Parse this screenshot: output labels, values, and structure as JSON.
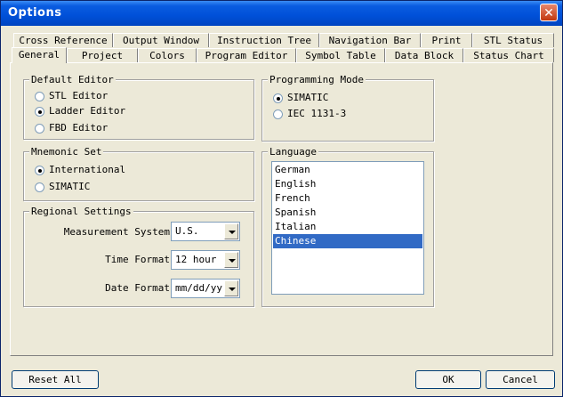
{
  "window": {
    "title": "Options"
  },
  "tabs_back": [
    "Cross Reference",
    "Output Window",
    "Instruction Tree",
    "Navigation Bar",
    "Print",
    "STL Status"
  ],
  "tabs_front": [
    "General",
    "Project",
    "Colors",
    "Program Editor",
    "Symbol Table",
    "Data Block",
    "Status Chart"
  ],
  "default_editor": {
    "legend": "Default Editor",
    "options": [
      "STL Editor",
      "Ladder Editor",
      "FBD Editor"
    ],
    "selected": "Ladder Editor"
  },
  "mnemonic_set": {
    "legend": "Mnemonic Set",
    "options": [
      "International",
      "SIMATIC"
    ],
    "selected": "International"
  },
  "regional": {
    "legend": "Regional Settings",
    "measurement_label": "Measurement System",
    "measurement_value": "U.S.",
    "time_label": "Time Format",
    "time_value": "12 hour",
    "date_label": "Date Format",
    "date_value": "mm/dd/yy"
  },
  "programming_mode": {
    "legend": "Programming Mode",
    "options": [
      "SIMATIC",
      "IEC 1131-3"
    ],
    "selected": "SIMATIC"
  },
  "language": {
    "legend": "Language",
    "items": [
      "German",
      "English",
      "French",
      "Spanish",
      "Italian",
      "Chinese"
    ],
    "selected": "Chinese"
  },
  "buttons": {
    "reset": "Reset All",
    "ok": "OK",
    "cancel": "Cancel"
  }
}
